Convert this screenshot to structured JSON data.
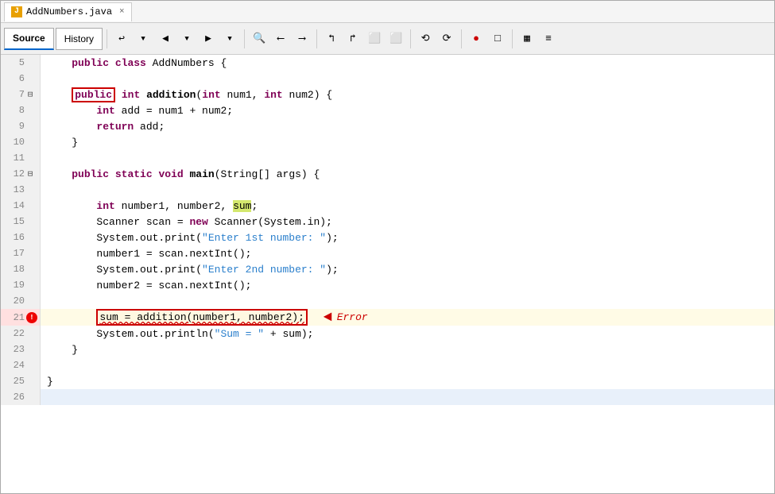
{
  "window": {
    "tab_label": "AddNumbers.java",
    "tab_close": "×"
  },
  "tabs": {
    "source_label": "Source",
    "history_label": "History"
  },
  "toolbar": {
    "buttons": [
      "↩",
      "▼",
      "▶",
      "▼",
      "⬜",
      "▼",
      "⬜",
      "⬜",
      "⬜",
      "⬜",
      "⬜",
      "⬜",
      "⬜",
      "⬜",
      "⬜",
      "⬜",
      "⬜",
      "⬜",
      "●",
      "□",
      "▦",
      "≡"
    ]
  },
  "lines": [
    {
      "num": "5",
      "indent": 1,
      "content": "public class AddNumbers {",
      "fold": null,
      "error": false
    },
    {
      "num": "6",
      "indent": 0,
      "content": "",
      "fold": null,
      "error": false
    },
    {
      "num": "7",
      "indent": 1,
      "content": "    public int addition(int num1, int num2) {",
      "fold": "minus",
      "error": false,
      "highlight_public": true
    },
    {
      "num": "8",
      "indent": 2,
      "content": "        int add = num1 + num2;",
      "fold": null,
      "error": false
    },
    {
      "num": "9",
      "indent": 2,
      "content": "        return add;",
      "fold": null,
      "error": false
    },
    {
      "num": "10",
      "indent": 1,
      "content": "    }",
      "fold": null,
      "error": false
    },
    {
      "num": "11",
      "indent": 0,
      "content": "",
      "fold": null,
      "error": false
    },
    {
      "num": "12",
      "indent": 1,
      "content": "    public static void main(String[] args) {",
      "fold": "minus",
      "error": false
    },
    {
      "num": "13",
      "indent": 0,
      "content": "",
      "fold": null,
      "error": false
    },
    {
      "num": "14",
      "indent": 2,
      "content": "        int number1, number2, sum;",
      "fold": null,
      "error": false,
      "highlight_sum": true
    },
    {
      "num": "15",
      "indent": 2,
      "content": "        Scanner scan = new Scanner(System.in);",
      "fold": null,
      "error": false
    },
    {
      "num": "16",
      "indent": 2,
      "content": "        System.out.print(\"Enter 1st number: \");",
      "fold": null,
      "error": false
    },
    {
      "num": "17",
      "indent": 2,
      "content": "        number1 = scan.nextInt();",
      "fold": null,
      "error": false
    },
    {
      "num": "18",
      "indent": 2,
      "content": "        System.out.print(\"Enter 2nd number: \");",
      "fold": null,
      "error": false
    },
    {
      "num": "19",
      "indent": 2,
      "content": "        number2 = scan.nextInt();",
      "fold": null,
      "error": false
    },
    {
      "num": "20",
      "indent": 0,
      "content": "",
      "fold": null,
      "error": false
    },
    {
      "num": "21",
      "indent": 2,
      "content": "        sum = addition(number1, number2);",
      "fold": null,
      "error": true,
      "error_label": "Error"
    },
    {
      "num": "22",
      "indent": 2,
      "content": "        System.out.println(\"Sum = \" + sum);",
      "fold": null,
      "error": false
    },
    {
      "num": "23",
      "indent": 1,
      "content": "    }",
      "fold": null,
      "error": false
    },
    {
      "num": "24",
      "indent": 0,
      "content": "",
      "fold": null,
      "error": false
    },
    {
      "num": "25",
      "indent": 0,
      "content": "}",
      "fold": null,
      "error": false
    },
    {
      "num": "26",
      "indent": 0,
      "content": "",
      "fold": null,
      "error": false
    }
  ]
}
